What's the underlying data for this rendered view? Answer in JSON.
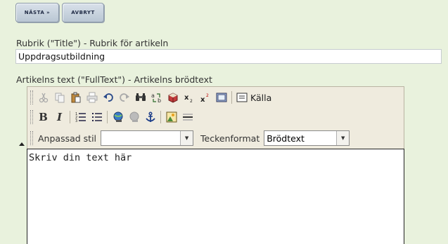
{
  "wizard": {
    "next_label": "NÄSTA »",
    "cancel_label": "AVBRYT"
  },
  "title_field": {
    "label": "Rubrik (\"Title\") - Rubrik för artikeln",
    "value": "Uppdragsutbildning"
  },
  "fulltext_field": {
    "label": "Artikelns text (\"FullText\") - Artikelns brödtext"
  },
  "editor": {
    "toolbar_row1": [
      "cut-icon",
      "copy-icon",
      "paste-icon",
      "print-icon",
      "undo-icon",
      "redo-icon",
      "find-icon",
      "replace-icon",
      "spellcheck-icon",
      "subscript-icon",
      "superscript-icon",
      "show-blocks-icon",
      "source-icon"
    ],
    "source_label": "Källa",
    "toolbar_row2": [
      "bold-icon",
      "italic-icon",
      "numbered-list-icon",
      "bulleted-list-icon",
      "link-icon",
      "unlink-icon",
      "anchor-icon",
      "image-icon",
      "horizontal-rule-icon"
    ],
    "style_label": "Anpassad stil",
    "style_value": "",
    "format_label": "Teckenformat",
    "format_value": "Brödtext",
    "content": "Skriv din text här"
  },
  "colors": {
    "page_background": "#e9f2dd",
    "toolbar_background": "#efebde"
  }
}
